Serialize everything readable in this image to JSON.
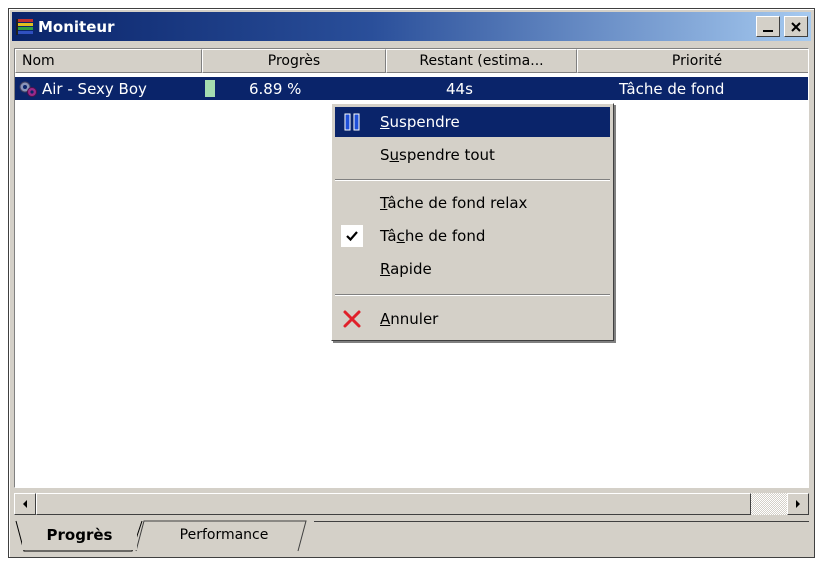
{
  "window": {
    "title": "Moniteur",
    "minimize_glyph": "_",
    "close_glyph": "✕"
  },
  "columns": [
    {
      "label": "Nom"
    },
    {
      "label": "Progrès"
    },
    {
      "label": "Restant (estima..."
    },
    {
      "label": "Priorité"
    }
  ],
  "rows": [
    {
      "name": "Air - Sexy Boy",
      "progress": "6.89 %",
      "progress_fraction": 0.0689,
      "remaining": "44s",
      "priority": "Tâche de fond",
      "icon": "gears-icon"
    }
  ],
  "context_menu": {
    "items": [
      {
        "pre": "",
        "u": "S",
        "post": "uspendre",
        "icon": "pause-icon",
        "selected": true
      },
      {
        "pre": "S",
        "u": "u",
        "post": "spendre tout",
        "icon": "",
        "selected": false
      },
      {
        "pre": "",
        "u": "T",
        "post": "âche de fond relax",
        "icon": "",
        "selected": false
      },
      {
        "pre": "Tâ",
        "u": "c",
        "post": "he de fond",
        "icon": "checkmark-icon",
        "selected": false
      },
      {
        "pre": "",
        "u": "R",
        "post": "apide",
        "icon": "",
        "selected": false
      },
      {
        "pre": "",
        "u": "A",
        "post": "nnuler",
        "icon": "cancel-x-icon",
        "selected": false
      }
    ]
  },
  "tabs": [
    {
      "label": "Progrès",
      "active": true
    },
    {
      "label": "Performance",
      "active": false
    }
  ],
  "colors": {
    "selection": "#0a246a",
    "face": "#d4d0c8",
    "progress_fill": "#a4dcb0",
    "cancel_red": "#e0202a"
  }
}
